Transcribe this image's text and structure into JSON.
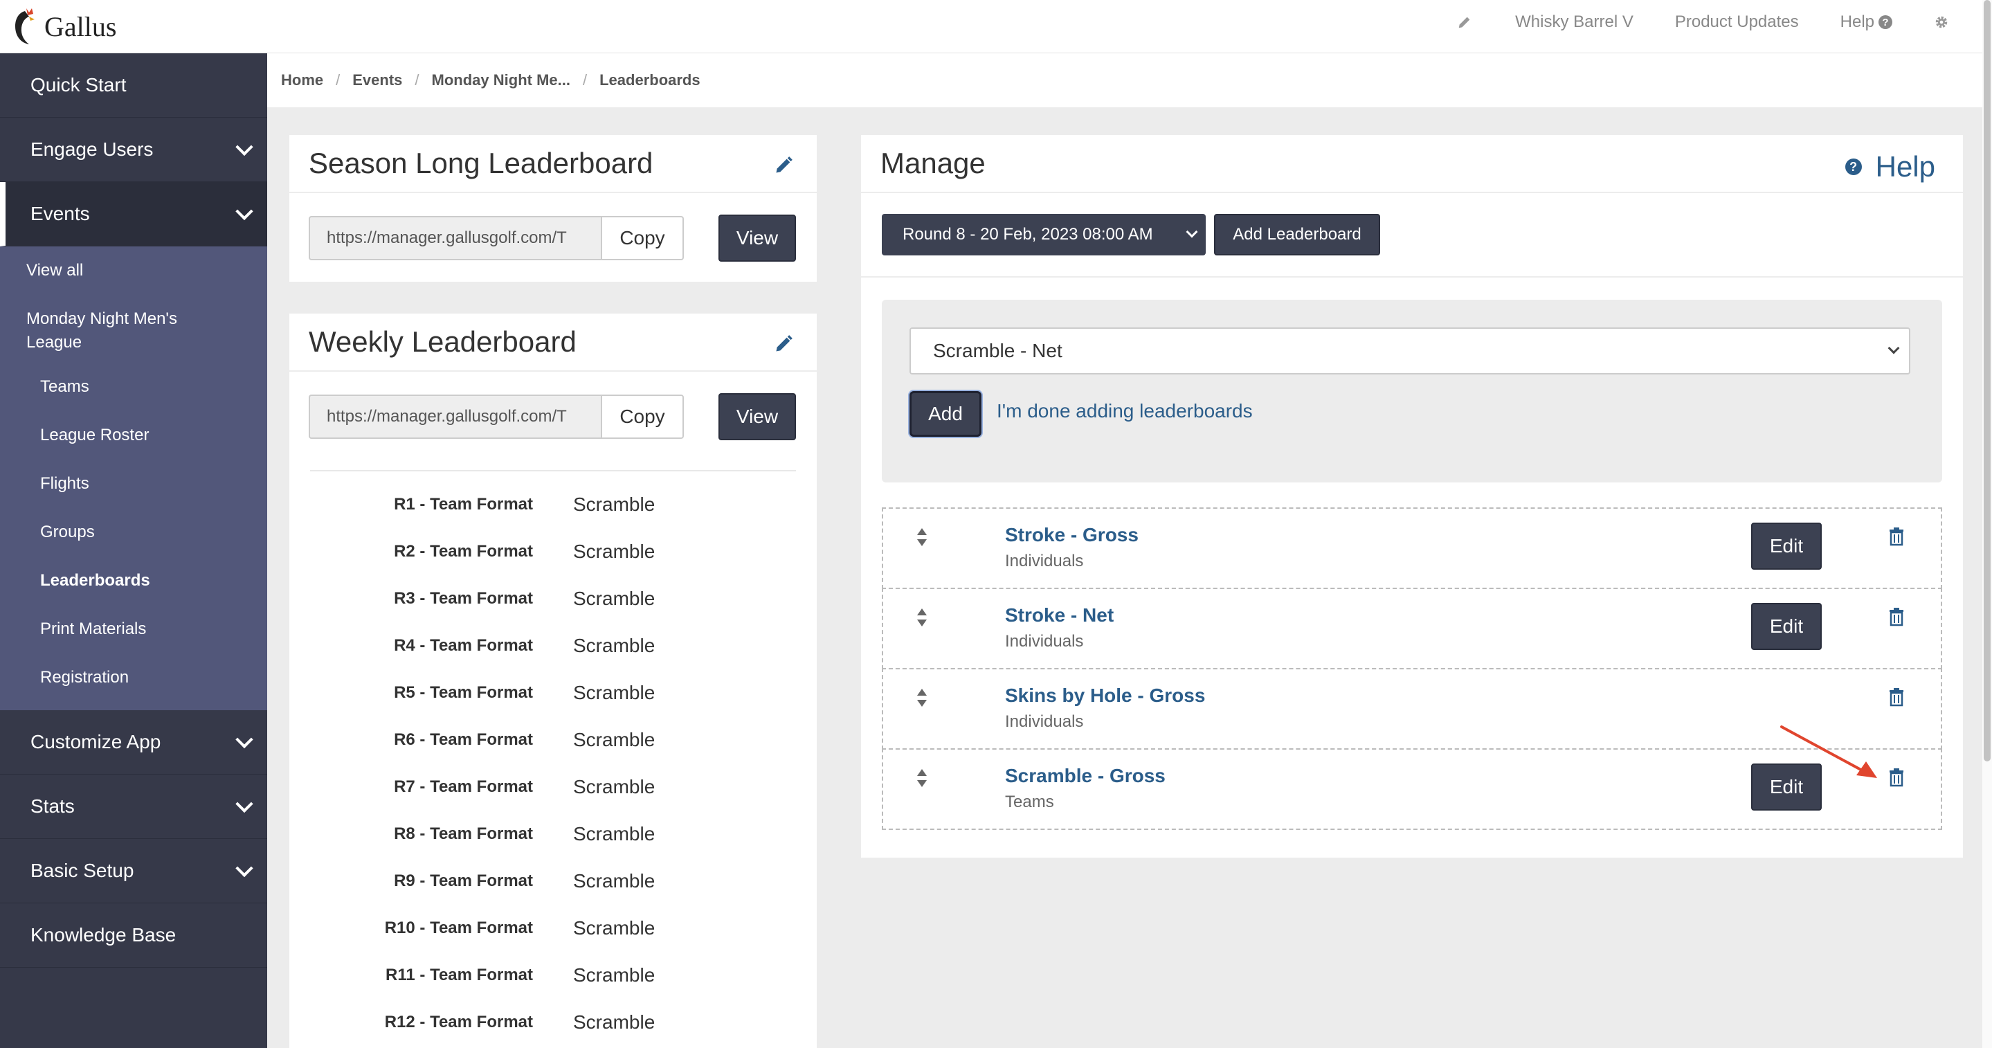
{
  "app": {
    "name": "Gallus"
  },
  "topnav": {
    "course": "Whisky Barrel V",
    "updates": "Product Updates",
    "help": "Help"
  },
  "sidebar": {
    "quick_start": "Quick Start",
    "engage": "Engage Users",
    "events": "Events",
    "events_sub": {
      "view_all": "View all",
      "league": "Monday Night Men's League",
      "teams": "Teams",
      "roster": "League Roster",
      "flights": "Flights",
      "groups": "Groups",
      "leaderboards": "Leaderboards",
      "print": "Print Materials",
      "registration": "Registration"
    },
    "customize": "Customize App",
    "stats": "Stats",
    "basic_setup": "Basic Setup",
    "knowledge_base": "Knowledge Base"
  },
  "breadcrumb": {
    "home": "Home",
    "events": "Events",
    "league": "Monday Night Me...",
    "current": "Leaderboards"
  },
  "season": {
    "title": "Season Long Leaderboard",
    "url": "https://manager.gallusgolf.com/T",
    "copy": "Copy",
    "view": "View"
  },
  "weekly": {
    "title": "Weekly Leaderboard",
    "url": "https://manager.gallusgolf.com/T",
    "copy": "Copy",
    "view": "View",
    "rounds": [
      {
        "key": "R1 - Team Format",
        "value": "Scramble"
      },
      {
        "key": "R2 - Team Format",
        "value": "Scramble"
      },
      {
        "key": "R3 - Team Format",
        "value": "Scramble"
      },
      {
        "key": "R4 - Team Format",
        "value": "Scramble"
      },
      {
        "key": "R5 - Team Format",
        "value": "Scramble"
      },
      {
        "key": "R6 - Team Format",
        "value": "Scramble"
      },
      {
        "key": "R7 - Team Format",
        "value": "Scramble"
      },
      {
        "key": "R8 - Team Format",
        "value": "Scramble"
      },
      {
        "key": "R9 - Team Format",
        "value": "Scramble"
      },
      {
        "key": "R10 - Team Format",
        "value": "Scramble"
      },
      {
        "key": "R11 - Team Format",
        "value": "Scramble"
      },
      {
        "key": "R12 - Team Format",
        "value": "Scramble"
      }
    ]
  },
  "manage": {
    "title": "Manage",
    "help": "Help",
    "round_select": "Round 8 - 20 Feb, 2023 08:00 AM",
    "add_leaderboard": "Add Leaderboard",
    "lb_select": "Scramble - Net",
    "add": "Add",
    "done": "I'm done adding leaderboards",
    "edit_label": "Edit",
    "leaderboards": [
      {
        "name": "Stroke - Gross",
        "type": "Individuals",
        "editable": true
      },
      {
        "name": "Stroke - Net",
        "type": "Individuals",
        "editable": true
      },
      {
        "name": "Skins by Hole - Gross",
        "type": "Individuals",
        "editable": false
      },
      {
        "name": "Scramble - Gross",
        "type": "Teams",
        "editable": true
      }
    ]
  },
  "colors": {
    "sidebar": "#363949",
    "submenu": "#52577a",
    "button": "#3c4152",
    "link": "#2b5d8a",
    "arrow": "#e0452e"
  }
}
